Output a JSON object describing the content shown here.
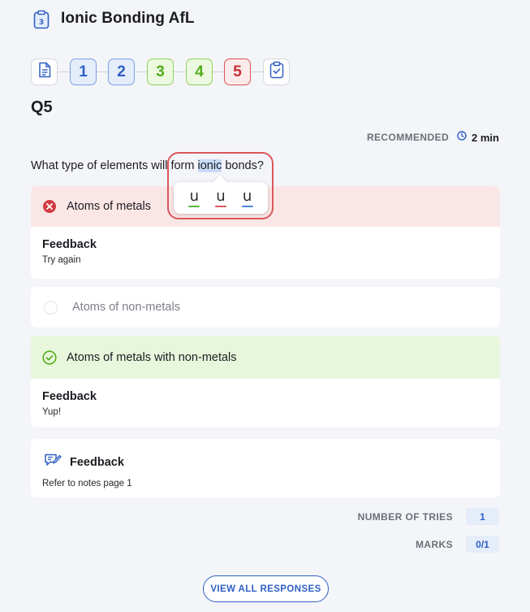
{
  "header": {
    "title": "Ionic Bonding AfL",
    "icon": "clipboard-3-icon"
  },
  "stepper": {
    "steps": [
      {
        "label": "1",
        "status": "partial"
      },
      {
        "label": "2",
        "status": "partial"
      },
      {
        "label": "3",
        "status": "correct"
      },
      {
        "label": "4",
        "status": "correct"
      },
      {
        "label": "5",
        "status": "incorrect",
        "current": true
      }
    ],
    "start_icon": "document-icon",
    "end_icon": "clipboard-check-icon"
  },
  "question": {
    "number": "Q5",
    "recommended_label": "RECOMMENDED",
    "recommended_time": "2 min",
    "text_before": "What type of elements will form ",
    "highlighted": "ionic",
    "text_after": " bonds?"
  },
  "options": [
    {
      "label": "Atoms of metals",
      "state": "incorrect",
      "feedback_title": "Feedback",
      "feedback_text": "Try again"
    },
    {
      "label": "Atoms of non-metals",
      "state": "unselected"
    },
    {
      "label": "Atoms of metals with non-metals",
      "state": "correct",
      "feedback_title": "Feedback",
      "feedback_text": "Yup!"
    }
  ],
  "general_feedback": {
    "title": "Feedback",
    "text": "Refer to notes page 1"
  },
  "stats": {
    "tries_label": "NUMBER OF TRIES",
    "tries_value": "1",
    "marks_label": "MARKS",
    "marks_value": "0/1"
  },
  "view_all_label": "VIEW ALL RESPONSES",
  "highlight_popup": {
    "buttons": [
      {
        "glyph": "u",
        "color": "#56b83a"
      },
      {
        "glyph": "u",
        "color": "#d9575d"
      },
      {
        "glyph": "u",
        "color": "#4a86e0"
      }
    ]
  },
  "colors": {
    "primary": "#2f5fc4",
    "correct": "#52ad1c",
    "incorrect": "#c62e37",
    "correct_bg": "#e8f7dc",
    "incorrect_bg": "#fbe6e6"
  }
}
